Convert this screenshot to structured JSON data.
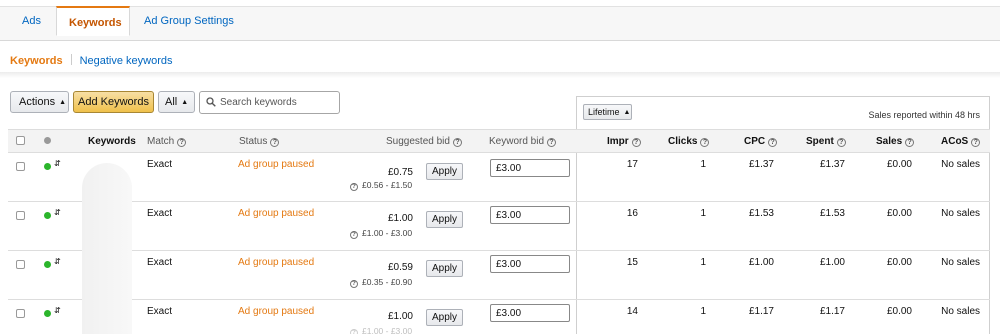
{
  "tabs": {
    "ads": "Ads",
    "keywords": "Keywords",
    "ad_group_settings": "Ad Group Settings"
  },
  "subnav": {
    "keywords": "Keywords",
    "negative_keywords": "Negative keywords"
  },
  "toolbar": {
    "actions_label": "Actions",
    "add_keywords_label": "Add Keywords",
    "filter_label": "All",
    "search_placeholder": "Search keywords"
  },
  "metrics_panel": {
    "period_label": "Lifetime",
    "note": "Sales reported within 48 hrs"
  },
  "columns": {
    "keywords": "Keywords",
    "match": "Match",
    "status": "Status",
    "suggested_bid": "Suggested bid",
    "keyword_bid": "Keyword bid",
    "impr": "Impr",
    "clicks": "Clicks",
    "cpc": "CPC",
    "spent": "Spent",
    "sales": "Sales",
    "acos": "ACoS"
  },
  "apply_label": "Apply",
  "status_colors": {
    "active_dot": "#2bb52b",
    "paused_text": "#e47911"
  },
  "rows": [
    {
      "match": "Exact",
      "status": "Ad group paused",
      "suggested_bid": "£0.75",
      "bid_range": "£0.56 - £1.50",
      "keyword_bid": "£3.00",
      "impr": "17",
      "clicks": "1",
      "cpc": "£1.37",
      "spent": "£1.37",
      "sales": "£0.00",
      "acos": "No sales"
    },
    {
      "match": "Exact",
      "status": "Ad group paused",
      "suggested_bid": "£1.00",
      "bid_range": "£1.00 - £3.00",
      "keyword_bid": "£3.00",
      "impr": "16",
      "clicks": "1",
      "cpc": "£1.53",
      "spent": "£1.53",
      "sales": "£0.00",
      "acos": "No sales"
    },
    {
      "match": "Exact",
      "status": "Ad group paused",
      "suggested_bid": "£0.59",
      "bid_range": "£0.35 - £0.90",
      "keyword_bid": "£3.00",
      "impr": "15",
      "clicks": "1",
      "cpc": "£1.00",
      "spent": "£1.00",
      "sales": "£0.00",
      "acos": "No sales"
    },
    {
      "match": "Exact",
      "status": "Ad group paused",
      "suggested_bid": "£1.00",
      "bid_range": "£1.00 - £3.00",
      "keyword_bid": "£3.00",
      "impr": "14",
      "clicks": "1",
      "cpc": "£1.17",
      "spent": "£1.17",
      "sales": "£0.00",
      "acos": "No sales"
    }
  ]
}
